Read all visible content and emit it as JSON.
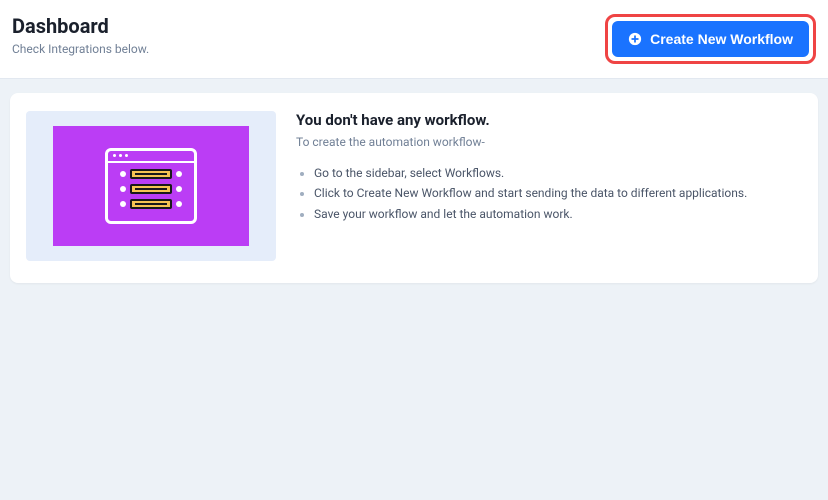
{
  "header": {
    "title": "Dashboard",
    "subtitle": "Check Integrations below.",
    "create_button": "Create New Workflow"
  },
  "empty_state": {
    "title": "You don't have any workflow.",
    "subtitle": "To create the automation workflow-",
    "steps": [
      "Go to the sidebar, select Workflows.",
      "Click to Create New Workflow and start sending the data to different applications.",
      "Save your workflow and let the automation work."
    ]
  }
}
